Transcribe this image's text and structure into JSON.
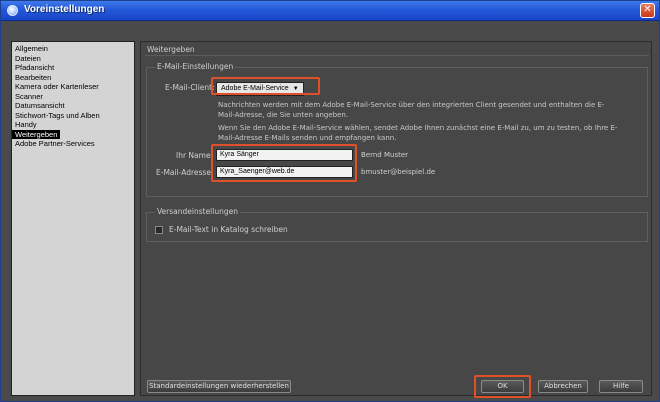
{
  "window": {
    "title": "Voreinstellungen",
    "close_symbol": "✕"
  },
  "sidebar": {
    "items": [
      {
        "label": "Allgemein"
      },
      {
        "label": "Dateien"
      },
      {
        "label": "Pfadansicht"
      },
      {
        "label": "Bearbeiten"
      },
      {
        "label": "Kamera oder Kartenleser"
      },
      {
        "label": "Scanner"
      },
      {
        "label": "Datumsansicht"
      },
      {
        "label": "Stichwort-Tags und Alben"
      },
      {
        "label": "Handy"
      },
      {
        "label": "Weitergeben",
        "selected": true
      },
      {
        "label": "Adobe Partner-Services"
      }
    ]
  },
  "main": {
    "section_title": "Weitergeben",
    "email_group": {
      "label": "E-Mail-Einstellungen",
      "client_label": "E-Mail-Client:",
      "client_value": "Adobe E-Mail-Service",
      "help_text_1": "Nachrichten werden mit dem Adobe E-Mail-Service über den integrierten Client gesendet und enthalten die E-Mail-Adresse, die Sie unten angeben.",
      "help_text_2": "Wenn Sie den Adobe E-Mail-Service wählen, sendet Adobe Ihnen zunächst eine E-Mail zu, um zu testen, ob Ihre E-Mail-Adresse E-Mails senden und empfangen kann.",
      "name_label": "Ihr Name:",
      "name_value": "Kyra Sänger",
      "name_example": "Bernd Muster",
      "address_label": "E-Mail-Adresse:",
      "address_value": "Kyra_Saenger@web.de",
      "address_example": "bmuster@beispiel.de"
    },
    "shipping_group": {
      "label": "Versandeinstellungen",
      "checkbox_label": "E-Mail-Text in Katalog schreiben",
      "checkbox_checked": false
    }
  },
  "footer": {
    "reset_label": "Standardeinstellungen wiederherstellen",
    "ok_label": "OK",
    "cancel_label": "Abbrechen",
    "help_label": "Hilfe"
  },
  "colors": {
    "highlight": "#e0502a",
    "titlebar": "#2458d8"
  }
}
